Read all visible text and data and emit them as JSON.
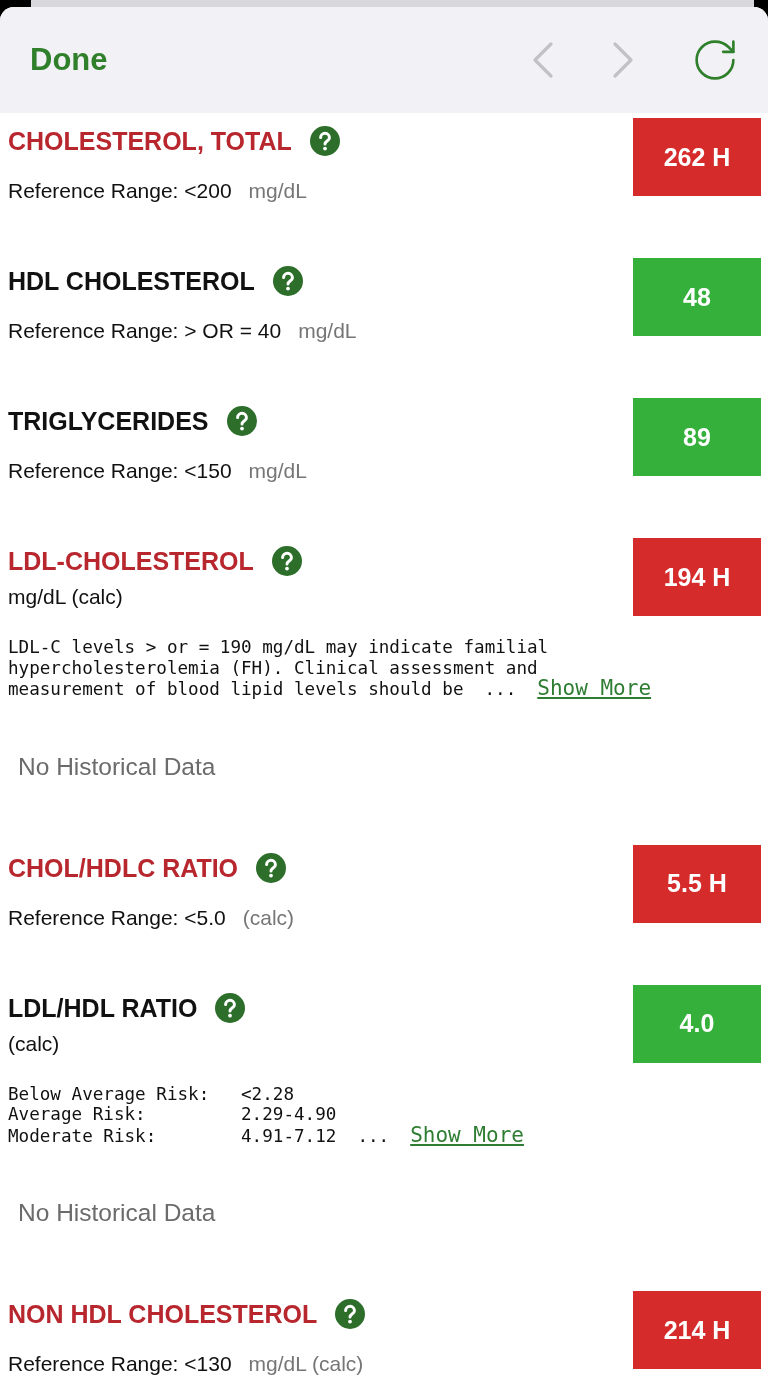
{
  "toolbar": {
    "done": "Done",
    "back": {
      "disabled": true
    },
    "forward": {
      "disabled": true
    }
  },
  "results": [
    {
      "name": "CHOLESTEROL, TOTAL",
      "high": true,
      "value": "262 H",
      "reference": "Reference Range: <200",
      "unit": "mg/dL"
    },
    {
      "name": "HDL CHOLESTEROL",
      "high": false,
      "value": "48",
      "reference": "Reference Range: > OR = 40",
      "unit": "mg/dL"
    },
    {
      "name": "TRIGLYCERIDES",
      "high": false,
      "value": "89",
      "reference": "Reference Range: <150",
      "unit": "mg/dL"
    },
    {
      "name": "LDL-CHOLESTEROL",
      "high": true,
      "value": "194 H",
      "units": "mg/dL (calc)",
      "note": {
        "lines": [
          "LDL-C levels > or = 190 mg/dL may indicate familial",
          "hypercholesterolemia (FH). Clinical assessment and",
          "measurement of blood lipid levels should be"
        ],
        "ellipsis": "...",
        "link": "Show More"
      },
      "history": "No Historical Data"
    },
    {
      "name": "CHOL/HDLC RATIO",
      "high": true,
      "value": "5.5 H",
      "reference": "Reference Range: <5.0",
      "unit": "(calc)"
    },
    {
      "name": "LDL/HDL RATIO",
      "high": false,
      "value": "4.0",
      "units": "(calc)",
      "note": {
        "lines": [
          "Below Average Risk:   <2.28",
          "Average Risk:         2.29-4.90",
          "Moderate Risk:        4.91-7.12"
        ],
        "ellipsis": "...",
        "link": "Show More"
      },
      "history": "No Historical Data"
    },
    {
      "name": "NON HDL CHOLESTEROL",
      "high": true,
      "value": "214 H",
      "reference": "Reference Range: <130",
      "unit": "mg/dL (calc)"
    }
  ]
}
